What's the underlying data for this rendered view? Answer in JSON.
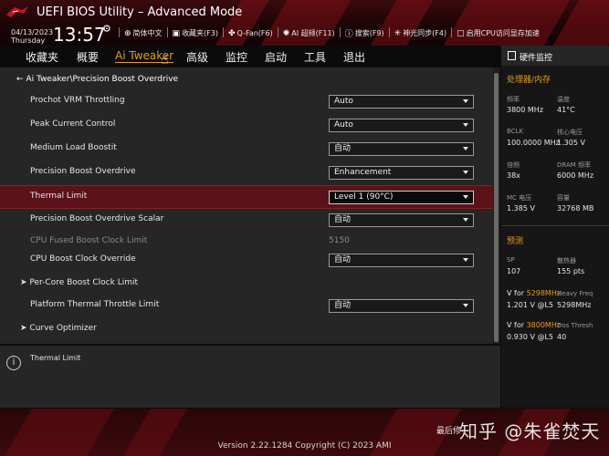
{
  "header": {
    "title": "UEFI BIOS Utility – Advanced Mode",
    "date": "04/13/2023",
    "weekday": "Thursday",
    "time": "13:57",
    "tools": [
      {
        "icon": "globe-icon",
        "label": "简体中文"
      },
      {
        "icon": "favorites-icon",
        "label": "收藏夹(F3)"
      },
      {
        "icon": "fan-icon",
        "label": "Q-Fan(F6)"
      },
      {
        "icon": "ai-icon",
        "label": "AI 超频(F11)"
      },
      {
        "icon": "help-icon",
        "label": "搜索(F9)"
      },
      {
        "icon": "sync-icon",
        "label": "神光同步(F4)"
      },
      {
        "icon": "lock-icon",
        "label": "启用CPU访问显存加速"
      }
    ]
  },
  "menu": {
    "items": [
      "收藏夹",
      "概要",
      "Ai Tweaker",
      "高级",
      "监控",
      "启动",
      "工具",
      "退出"
    ],
    "active": "Ai Tweaker"
  },
  "main": {
    "breadcrumb": "Ai Tweaker\\Precision Boost Overdrive",
    "rows": [
      {
        "label": "Prochot VRM Throttling",
        "value": "Auto",
        "type": "dropdown"
      },
      {
        "label": "Peak Current Control",
        "value": "Auto",
        "type": "dropdown"
      },
      {
        "label": "Medium Load Boostit",
        "value": "自动",
        "type": "dropdown"
      },
      {
        "label": "Precision Boost Overdrive",
        "value": "Enhancement",
        "type": "dropdown"
      },
      {
        "label": "Thermal Limit",
        "value": "Level 1 (90°C)",
        "type": "dropdown",
        "selected": true
      },
      {
        "label": "Precision Boost Overdrive Scalar",
        "value": "自动",
        "type": "dropdown"
      },
      {
        "label": "CPU Fused Boost Clock Limit",
        "value": "5150",
        "type": "readonly"
      },
      {
        "label": "CPU Boost Clock Override",
        "value": "自动",
        "type": "dropdown"
      },
      {
        "label": "Per-Core Boost Clock Limit",
        "type": "submenu"
      },
      {
        "label": "Platform Thermal Throttle Limit",
        "value": "自动",
        "type": "dropdown"
      },
      {
        "label": "Curve Optimizer",
        "type": "submenu"
      }
    ]
  },
  "help": {
    "text": "Thermal Limit"
  },
  "hardware_monitor": {
    "title": "硬件监控",
    "processor_section": "处理器/内存",
    "pairs": [
      {
        "k1": "频率",
        "v1": "3800 MHz",
        "k2": "温度",
        "v2": "41°C"
      },
      {
        "k1": "BCLK",
        "v1": "100.0000 MHz",
        "k2": "核心电压",
        "v2": "1.305 V"
      },
      {
        "k1": "倍频",
        "v1": "38x",
        "k2": "DRAM 频率",
        "v2": "6000 MHz"
      },
      {
        "k1": "MC 电压",
        "v1": "1.385 V",
        "k2": "容量",
        "v2": "32768 MB"
      }
    ],
    "prediction_section": "预测",
    "pred": [
      {
        "k1": "SP",
        "v1": "107",
        "k2": "散热器",
        "v2": "155 pts"
      },
      {
        "k1_a": "V for ",
        "k1_b": "5298MHz",
        "v1": "1.201 V @L5",
        "k2": "Heavy Freq",
        "v2": "5298MHz"
      },
      {
        "k1_a": "V for ",
        "k1_b": "3800MHz",
        "v1": "0.930 V @L5",
        "k2": "Dos Thresh",
        "v2": "40"
      }
    ]
  },
  "footer": {
    "last_modified": "最后修",
    "version": "Version 2.22.1284 Copyright (C) 2023 AMI",
    "watermark": "知乎 @朱雀焚天"
  },
  "colors": {
    "accent": "#e39b1d",
    "selected_row": "#5a1218",
    "header_red": "#8f1119"
  }
}
